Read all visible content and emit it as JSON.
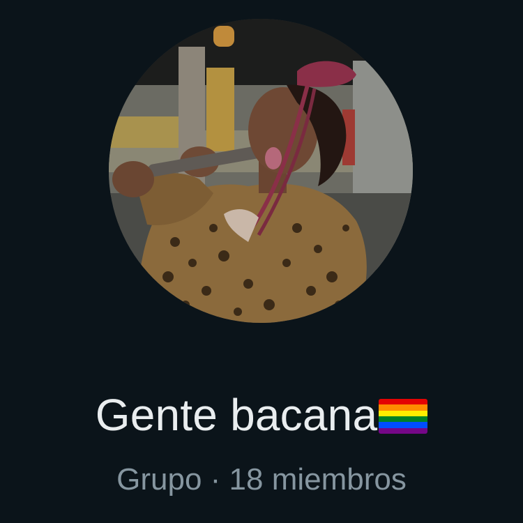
{
  "group": {
    "name": "Gente bacana",
    "type_label": "Grupo",
    "separator": "·",
    "members_label": "18 miembros"
  },
  "avatar": {
    "description_icon": "group-profile-photo"
  },
  "flag": {
    "icon": "rainbow-flag-icon",
    "stripes": [
      "#e40303",
      "#ff8c00",
      "#ffed00",
      "#008026",
      "#004dff",
      "#750787"
    ]
  },
  "colors": {
    "background": "#0b141a",
    "primary_text": "#e9edef",
    "secondary_text": "#8696a0"
  }
}
